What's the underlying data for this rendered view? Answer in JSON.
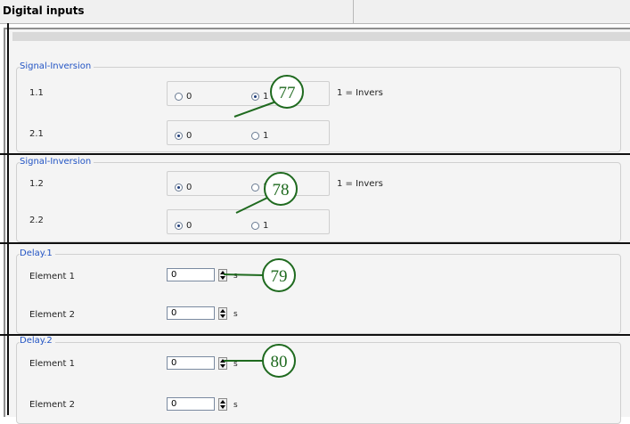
{
  "window": {
    "tab_title": "Digital inputs"
  },
  "groups": [
    {
      "legend": "Signal-Inversion",
      "rows": [
        {
          "label": "1.1",
          "options": [
            "0",
            "1"
          ],
          "selected": "1",
          "note": "1 = Invers"
        },
        {
          "label": "2.1",
          "options": [
            "0",
            "1"
          ],
          "selected": "0"
        }
      ]
    },
    {
      "legend": "Signal-Inversion",
      "rows": [
        {
          "label": "1.2",
          "options": [
            "0",
            "1"
          ],
          "selected": "0",
          "note": "1 = Invers"
        },
        {
          "label": "2.2",
          "options": [
            "0",
            "1"
          ],
          "selected": "0"
        }
      ]
    },
    {
      "legend": "Delay.1",
      "rows": [
        {
          "label": "Element 1",
          "value": "0",
          "unit": "s"
        },
        {
          "label": "Element 2",
          "value": "0",
          "unit": "s"
        }
      ]
    },
    {
      "legend": "Delay.2",
      "rows": [
        {
          "label": "Element 1",
          "value": "0",
          "unit": "s"
        },
        {
          "label": "Element 2",
          "value": "0",
          "unit": "s"
        }
      ]
    }
  ],
  "callouts": [
    "77",
    "78",
    "79",
    "80"
  ],
  "colors": {
    "legend_text": "#2254c4",
    "callout": "#1f6a1f",
    "panel": "#f4f4f4"
  }
}
